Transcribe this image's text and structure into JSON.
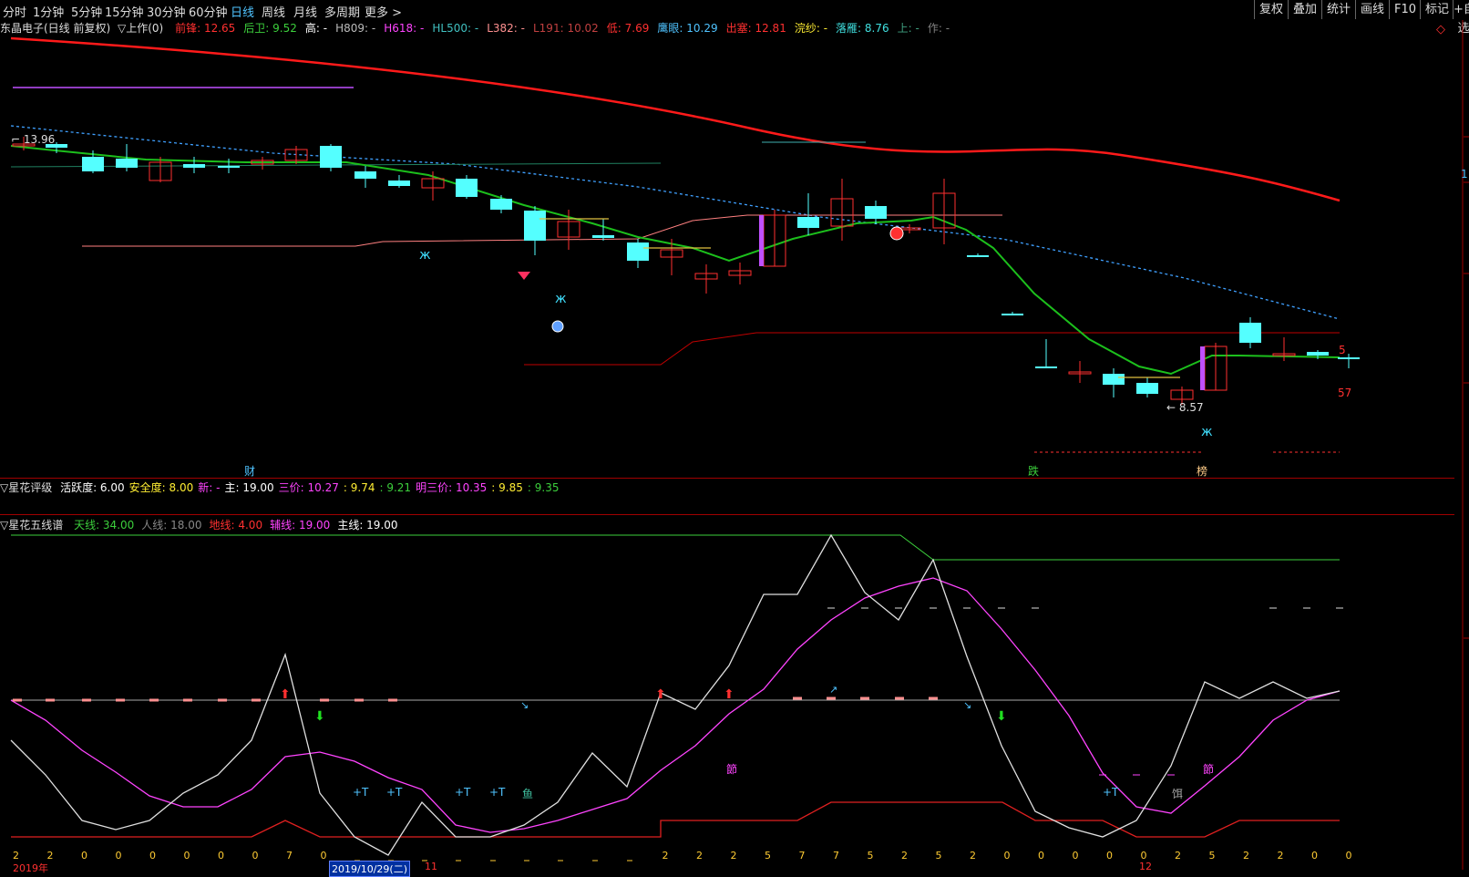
{
  "topbar": {
    "tabs": [
      {
        "label": "分时",
        "active": false
      },
      {
        "label": "1分钟",
        "active": false
      },
      {
        "label": "5分钟",
        "active": false
      },
      {
        "label": "15分钟",
        "active": false
      },
      {
        "label": "30分钟",
        "active": false
      },
      {
        "label": "60分钟",
        "active": false
      },
      {
        "label": "日线",
        "active": true
      },
      {
        "label": "周线",
        "active": false
      },
      {
        "label": "月线",
        "active": false
      },
      {
        "label": "多周期",
        "active": false
      },
      {
        "label": "更多 >",
        "active": false
      }
    ],
    "right_buttons": [
      "复权",
      "叠加",
      "统计",
      "画线",
      "F10",
      "标记",
      "+自选"
    ]
  },
  "main_header": {
    "stock": "东晶电子(日线 前复权)",
    "indicator_name": "▽上作(0)",
    "items": [
      {
        "label": "前锋:",
        "value": "12.65",
        "color": "#ff3030"
      },
      {
        "label": "后卫:",
        "value": "9.52",
        "color": "#3ccf3c"
      },
      {
        "label": "高:",
        "value": "-",
        "color": "#ffffff"
      },
      {
        "label": "H809:",
        "value": "-",
        "color": "#bbbbbb"
      },
      {
        "label": "H618:",
        "value": "-",
        "color": "#ff44ff"
      },
      {
        "label": "HL500:",
        "value": "-",
        "color": "#40c0c0"
      },
      {
        "label": "L382:",
        "value": "-",
        "color": "#ff9090"
      },
      {
        "label": "L191:",
        "value": "10.02",
        "color": "#c04040"
      },
      {
        "label": "低:",
        "value": "7.69",
        "color": "#ff3030"
      },
      {
        "label": "鹰眼:",
        "value": "10.29",
        "color": "#4fc3ff"
      },
      {
        "label": "出塞:",
        "value": "12.81",
        "color": "#ff3030"
      },
      {
        "label": "浣纱:",
        "value": "-",
        "color": "#ffee33"
      },
      {
        "label": "落雁:",
        "value": "8.76",
        "color": "#40e0e0"
      },
      {
        "label": "上:",
        "value": "-",
        "color": "#40a080"
      },
      {
        "label": "作:",
        "value": "-",
        "color": "#808080"
      }
    ]
  },
  "chart_labels": {
    "high_marker": "13.96",
    "low_marker": "8.57",
    "right_value_top": "5",
    "right_value_bottom": "57",
    "right_edge": "1",
    "tag_cai": "财",
    "tag_die": "跌",
    "tag_bang": "榜"
  },
  "panel2": {
    "title": "▽星花评级",
    "items": [
      {
        "label": "活跃度:",
        "value": "6.00",
        "color": "#ffffff"
      },
      {
        "label": "安全度:",
        "value": "8.00",
        "color": "#ffee33"
      },
      {
        "label": "新:",
        "value": "-",
        "color": "#ff44ff"
      },
      {
        "label": "主:",
        "value": "19.00",
        "color": "#ffffff"
      },
      {
        "label": "三价:",
        "value": "10.27",
        "color": "#ff44ff"
      },
      {
        "label": ":",
        "value": "9.74",
        "color": "#ffee33"
      },
      {
        "label": ":",
        "value": "9.21",
        "color": "#3ccf3c"
      },
      {
        "label": "明三价:",
        "value": "10.35",
        "color": "#ff44ff"
      },
      {
        "label": ":",
        "value": "9.85",
        "color": "#ffee33"
      },
      {
        "label": ":",
        "value": "9.35",
        "color": "#3ccf3c"
      }
    ]
  },
  "panel3": {
    "title": "▽星花五线谱",
    "items": [
      {
        "label": "天线:",
        "value": "34.00",
        "color": "#3ccf3c"
      },
      {
        "label": "人线:",
        "value": "18.00",
        "color": "#888888"
      },
      {
        "label": "地线:",
        "value": "4.00",
        "color": "#ff3030"
      },
      {
        "label": "辅线:",
        "value": "19.00",
        "color": "#ff44ff"
      },
      {
        "label": "主线:",
        "value": "19.00",
        "color": "#ffffff"
      }
    ],
    "markers": {
      "plusT": "+T",
      "yu": "鱼",
      "jie": "節",
      "er": "饵"
    }
  },
  "bottom_counts": [
    "2",
    "2",
    "0",
    "0",
    "0",
    "0",
    "0",
    "0",
    "7",
    "0",
    "",
    "",
    "",
    "",
    "",
    "",
    "",
    "",
    "",
    "2",
    "2",
    "2",
    "5",
    "7",
    "7",
    "5",
    "2",
    "5",
    "2",
    "0",
    "0",
    "0",
    "0",
    "0",
    "2",
    "5",
    "2",
    "2",
    "0",
    "0"
  ],
  "date_axis": {
    "year": "2019年",
    "cursor_date": "2019/10/29(二)",
    "month_11": "11",
    "month_12": "12"
  },
  "colors": {
    "up": "#ff3030",
    "down": "#54ffff",
    "ma_green": "#1cbf1c",
    "ma_red": "#ff1a1a",
    "ma_cyan_dotted": "#3fa0ff",
    "purple": "#c050ff"
  }
}
